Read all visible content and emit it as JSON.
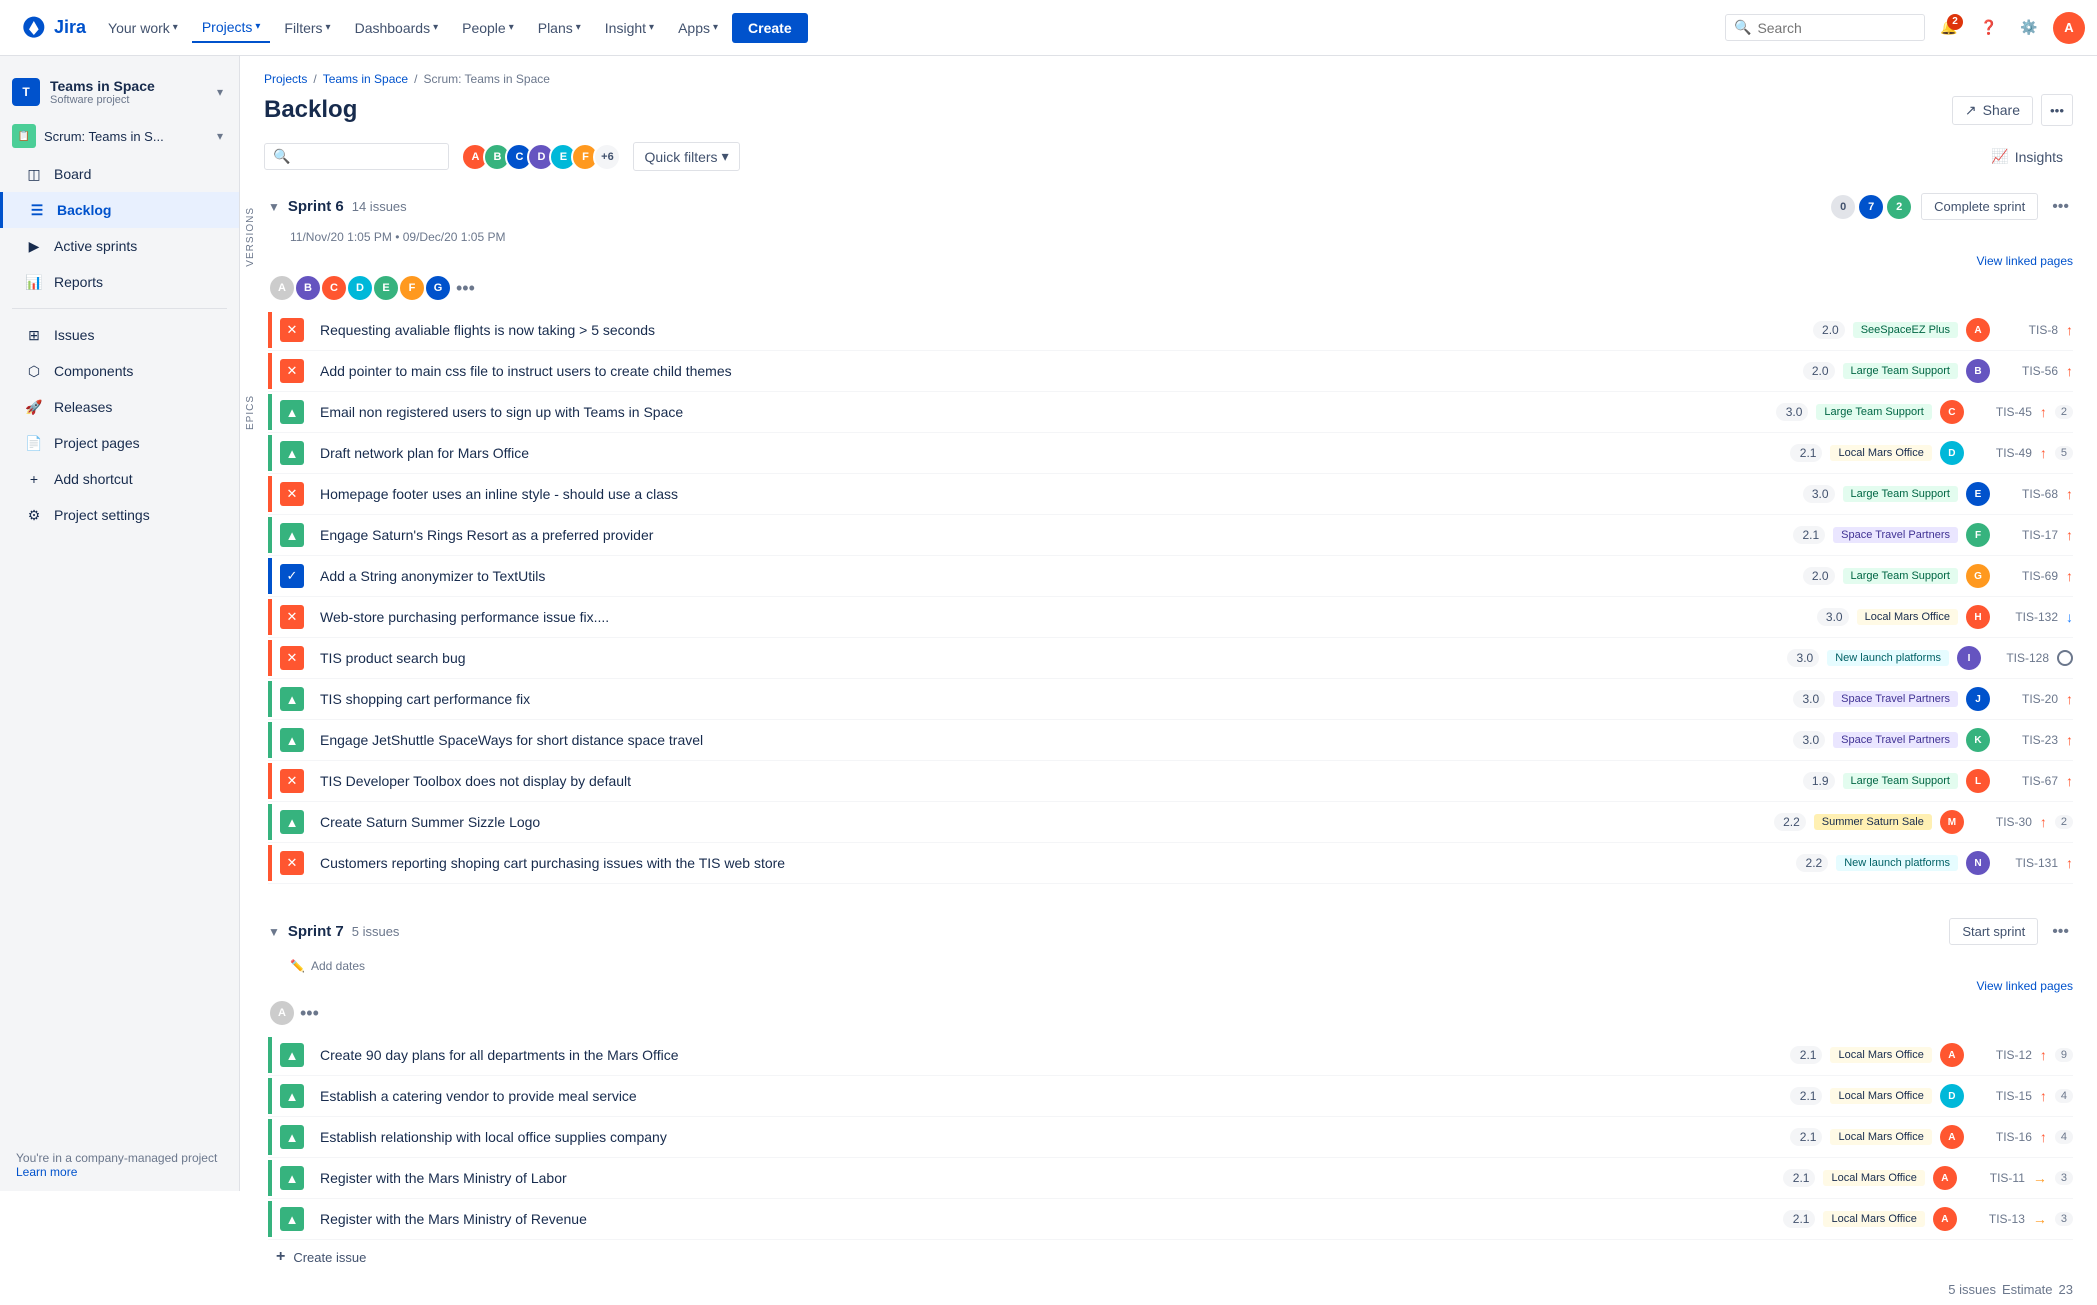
{
  "nav": {
    "logo_text": "Jira",
    "your_work": "Your work",
    "projects": "Projects",
    "filters": "Filters",
    "dashboards": "Dashboards",
    "people": "People",
    "plans": "Plans",
    "insight": "Insight",
    "apps": "Apps",
    "create": "Create",
    "search_placeholder": "Search",
    "notifications_count": "2"
  },
  "breadcrumb": {
    "projects": "Projects",
    "teams_in_space": "Teams in Space",
    "scrum": "Scrum: Teams in Space"
  },
  "page": {
    "title": "Backlog",
    "share": "Share",
    "insights": "Insights"
  },
  "toolbar": {
    "quick_filters": "Quick filters",
    "avatar_more": "+6"
  },
  "sidebar": {
    "project_name": "Teams in Space",
    "project_type": "Software project",
    "scrum_name": "Scrum: Teams in S...",
    "board": "Board",
    "backlog": "Backlog",
    "active_sprints": "Active sprints",
    "reports": "Reports",
    "issues": "Issues",
    "components": "Components",
    "releases": "Releases",
    "project_pages": "Project pages",
    "add_shortcut": "Add shortcut",
    "project_settings": "Project settings",
    "footer": "You're in a company-managed project",
    "learn_more": "Learn more"
  },
  "sprint6": {
    "name": "Sprint 6",
    "issues_count": "14 issues",
    "start_date": "11/Nov/20 1:05 PM",
    "end_date": "09/Dec/20 1:05 PM",
    "status_todo": "0",
    "status_inprog": "7",
    "status_done": "2",
    "complete_sprint": "Complete sprint",
    "view_linked_pages": "View linked pages",
    "issues": [
      {
        "type": "bug",
        "bar": "red",
        "summary": "Requesting avaliable flights is now taking > 5 seconds",
        "points": "2.0",
        "epic": "SeeSpaceEZ Plus",
        "epic_class": "epic-seespace",
        "assignee_color": "#ff5630",
        "assignee_initials": "A",
        "key": "TIS-8",
        "priority": "high",
        "comment": ""
      },
      {
        "type": "bug",
        "bar": "red",
        "summary": "Add pointer to main css file to instruct users to create child themes",
        "points": "2.0",
        "epic": "Large Team Support",
        "epic_class": "epic-large-team",
        "assignee_color": "#6554c0",
        "assignee_initials": "B",
        "key": "TIS-56",
        "priority": "high",
        "comment": ""
      },
      {
        "type": "story",
        "bar": "green",
        "summary": "Email non registered users to sign up with Teams in Space",
        "points": "3.0",
        "epic": "Large Team Support",
        "epic_class": "epic-large-team",
        "assignee_color": "#ff5630",
        "assignee_initials": "C",
        "key": "TIS-45",
        "priority": "high",
        "comment": "2"
      },
      {
        "type": "story",
        "bar": "green",
        "summary": "Draft network plan for Mars Office",
        "points": "2.1",
        "epic": "Local Mars Office",
        "epic_class": "epic-local-mars",
        "assignee_color": "#00b8d9",
        "assignee_initials": "D",
        "key": "TIS-49",
        "priority": "high",
        "comment": "5"
      },
      {
        "type": "bug",
        "bar": "red",
        "summary": "Homepage footer uses an inline style - should use a class",
        "points": "3.0",
        "epic": "Large Team Support",
        "epic_class": "epic-large-team",
        "assignee_color": "#0052cc",
        "assignee_initials": "E",
        "key": "TIS-68",
        "priority": "high",
        "comment": ""
      },
      {
        "type": "story",
        "bar": "green",
        "summary": "Engage Saturn's Rings Resort as a preferred provider",
        "points": "2.1",
        "epic": "Space Travel Partners",
        "epic_class": "epic-space-travel",
        "assignee_color": "#36b37e",
        "assignee_initials": "F",
        "key": "TIS-17",
        "priority": "high",
        "comment": ""
      },
      {
        "type": "task",
        "bar": "blue",
        "summary": "Add a String anonymizer to TextUtils",
        "points": "2.0",
        "epic": "Large Team Support",
        "epic_class": "epic-large-team",
        "assignee_color": "#ff991f",
        "assignee_initials": "G",
        "key": "TIS-69",
        "priority": "high",
        "comment": ""
      },
      {
        "type": "bug",
        "bar": "red",
        "summary": "Web-store purchasing performance issue fix....",
        "points": "3.0",
        "epic": "Local Mars Office",
        "epic_class": "epic-local-mars",
        "assignee_color": "#ff5630",
        "assignee_initials": "H",
        "key": "TIS-132",
        "priority": "low",
        "comment": ""
      },
      {
        "type": "bug",
        "bar": "red",
        "summary": "TIS product search bug",
        "points": "3.0",
        "epic": "New launch platforms",
        "epic_class": "epic-new-launch",
        "assignee_color": "#6554c0",
        "assignee_initials": "I",
        "key": "TIS-128",
        "priority": "none",
        "comment": ""
      },
      {
        "type": "story",
        "bar": "green",
        "summary": "TIS shopping cart performance fix",
        "points": "3.0",
        "epic": "Space Travel Partners",
        "epic_class": "epic-space-travel",
        "assignee_color": "#0052cc",
        "assignee_initials": "J",
        "key": "TIS-20",
        "priority": "high",
        "comment": ""
      },
      {
        "type": "story",
        "bar": "green",
        "summary": "Engage JetShuttle SpaceWays for short distance space travel",
        "points": "3.0",
        "epic": "Space Travel Partners",
        "epic_class": "epic-space-travel",
        "assignee_color": "#36b37e",
        "assignee_initials": "K",
        "key": "TIS-23",
        "priority": "high",
        "comment": ""
      },
      {
        "type": "bug",
        "bar": "red",
        "summary": "TIS Developer Toolbox does not display by default",
        "points": "1.9",
        "epic": "Large Team Support",
        "epic_class": "epic-large-team",
        "assignee_color": "#ff5630",
        "assignee_initials": "L",
        "key": "TIS-67",
        "priority": "high",
        "comment": ""
      },
      {
        "type": "story",
        "bar": "green",
        "summary": "Create Saturn Summer Sizzle Logo",
        "points": "2.2",
        "epic": "Summer Saturn Sale",
        "epic_class": "epic-summer-saturn",
        "assignee_color": "#ff5630",
        "assignee_initials": "M",
        "key": "TIS-30",
        "priority": "high",
        "comment": "2"
      },
      {
        "type": "bug",
        "bar": "red",
        "summary": "Customers reporting shoping cart purchasing issues with the TIS web store",
        "points": "2.2",
        "epic": "New launch platforms",
        "epic_class": "epic-new-launch",
        "assignee_color": "#6554c0",
        "assignee_initials": "N",
        "key": "TIS-131",
        "priority": "high",
        "comment": ""
      }
    ]
  },
  "sprint7": {
    "name": "Sprint 7",
    "issues_count": "5 issues",
    "start_sprint": "Start sprint",
    "add_dates": "Add dates",
    "view_linked_pages": "View linked pages",
    "issues": [
      {
        "type": "story",
        "bar": "green",
        "summary": "Create 90 day plans for all departments in the Mars Office",
        "points": "2.1",
        "epic": "Local Mars Office",
        "epic_class": "epic-local-mars",
        "assignee_color": "#ff5630",
        "assignee_initials": "A",
        "key": "TIS-12",
        "priority": "high",
        "comment": "9"
      },
      {
        "type": "story",
        "bar": "green",
        "summary": "Establish a catering vendor to provide meal service",
        "points": "2.1",
        "epic": "Local Mars Office",
        "epic_class": "epic-local-mars",
        "assignee_color": "#00b8d9",
        "assignee_initials": "D",
        "key": "TIS-15",
        "priority": "high",
        "comment": "4"
      },
      {
        "type": "story",
        "bar": "green",
        "summary": "Establish relationship with local office supplies company",
        "points": "2.1",
        "epic": "Local Mars Office",
        "epic_class": "epic-local-mars",
        "assignee_color": "#ff5630",
        "assignee_initials": "A",
        "key": "TIS-16",
        "priority": "high",
        "comment": "4"
      },
      {
        "type": "story",
        "bar": "green",
        "summary": "Register with the Mars Ministry of Labor",
        "points": "2.1",
        "epic": "Local Mars Office",
        "epic_class": "epic-local-mars",
        "assignee_color": "#ff5630",
        "assignee_initials": "A",
        "key": "TIS-11",
        "priority": "med",
        "comment": "3"
      },
      {
        "type": "story",
        "bar": "green",
        "summary": "Register with the Mars Ministry of Revenue",
        "points": "2.1",
        "epic": "Local Mars Office",
        "epic_class": "epic-local-mars",
        "assignee_color": "#ff5630",
        "assignee_initials": "A",
        "key": "TIS-13",
        "priority": "med",
        "comment": "3"
      }
    ],
    "footer_issues": "5 issues",
    "footer_estimate": "Estimate",
    "footer_points": "23"
  }
}
